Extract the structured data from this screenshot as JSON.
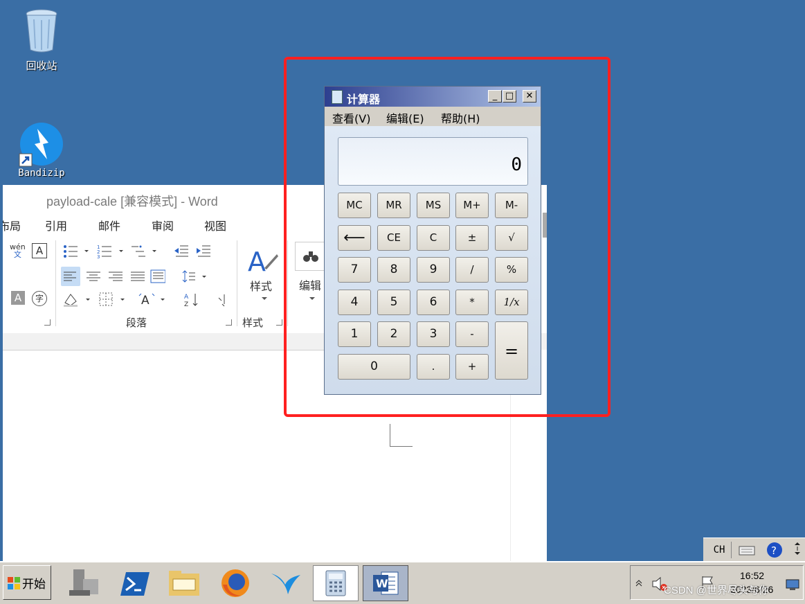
{
  "desktop": {
    "recycle_bin_label": "回收站",
    "bandizip_label": "Bandizip"
  },
  "word": {
    "title": "payload-cale [兼容模式] - Word",
    "tabs": [
      "布局",
      "引用",
      "邮件",
      "审阅",
      "视图"
    ],
    "groups": {
      "paragraph": "段落",
      "styles_label": "样式",
      "styles_group": "样式",
      "editing": "编辑"
    },
    "ribbon_glyphs": {
      "phonetic": "wén",
      "phonetic_sub": "文",
      "charborder": "A",
      "charshade": "A",
      "enclose": "字"
    }
  },
  "calculator": {
    "title": "计算器",
    "menu": [
      "查看(V)",
      "编辑(E)",
      "帮助(H)"
    ],
    "display": "0",
    "window_buttons": {
      "minimize": "_",
      "maximize": "□",
      "close": "✕"
    },
    "buttons": {
      "mc": "MC",
      "mr": "MR",
      "ms": "MS",
      "mplus": "M+",
      "mminus": "M-",
      "back": "⟵",
      "ce": "CE",
      "c": "C",
      "sign": "±",
      "sqrt": "√",
      "d7": "7",
      "d8": "8",
      "d9": "9",
      "div": "/",
      "pct": "%",
      "d4": "4",
      "d5": "5",
      "d6": "6",
      "mul": "*",
      "recip": "1/x",
      "d1": "1",
      "d2": "2",
      "d3": "3",
      "sub": "-",
      "eq": "=",
      "d0": "0",
      "dot": ".",
      "add": "+"
    }
  },
  "taskbar": {
    "start_label": "开始",
    "lang": "CH",
    "clock_time": "16:52",
    "clock_date": "2023/6/26",
    "watermark": "CSDN @世界尽头与你"
  },
  "colors": {
    "desktop": "#3a6ea5",
    "highlight_box": "#ff2020",
    "calc_title_start": "#2d3f8f",
    "calc_title_end": "#b2c5e8"
  }
}
